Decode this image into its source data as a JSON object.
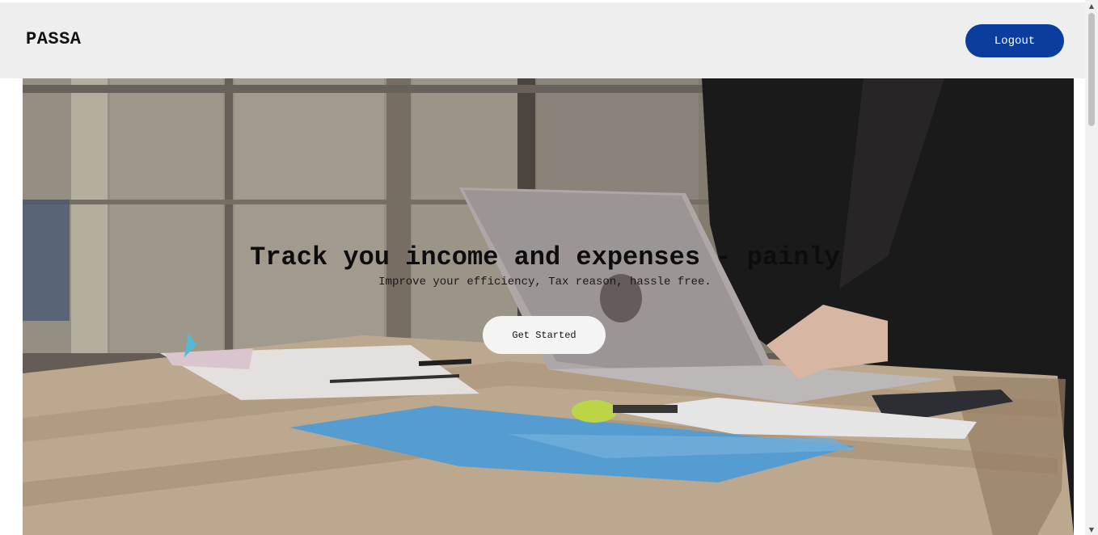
{
  "navbar": {
    "brand": "PASSA",
    "logout_label": "Logout"
  },
  "hero": {
    "title": "Track you income and expenses - painly",
    "subtitle": "Improve your efficiency, Tax reason, hassle free.",
    "cta_label": "Get Started"
  },
  "scrollbar": {
    "up_icon": "▲",
    "down_icon": "▼"
  },
  "colors": {
    "navbar_bg": "#eeeeee",
    "logout_bg": "#0a3d9e",
    "cta_bg": "#f4f4f4"
  }
}
